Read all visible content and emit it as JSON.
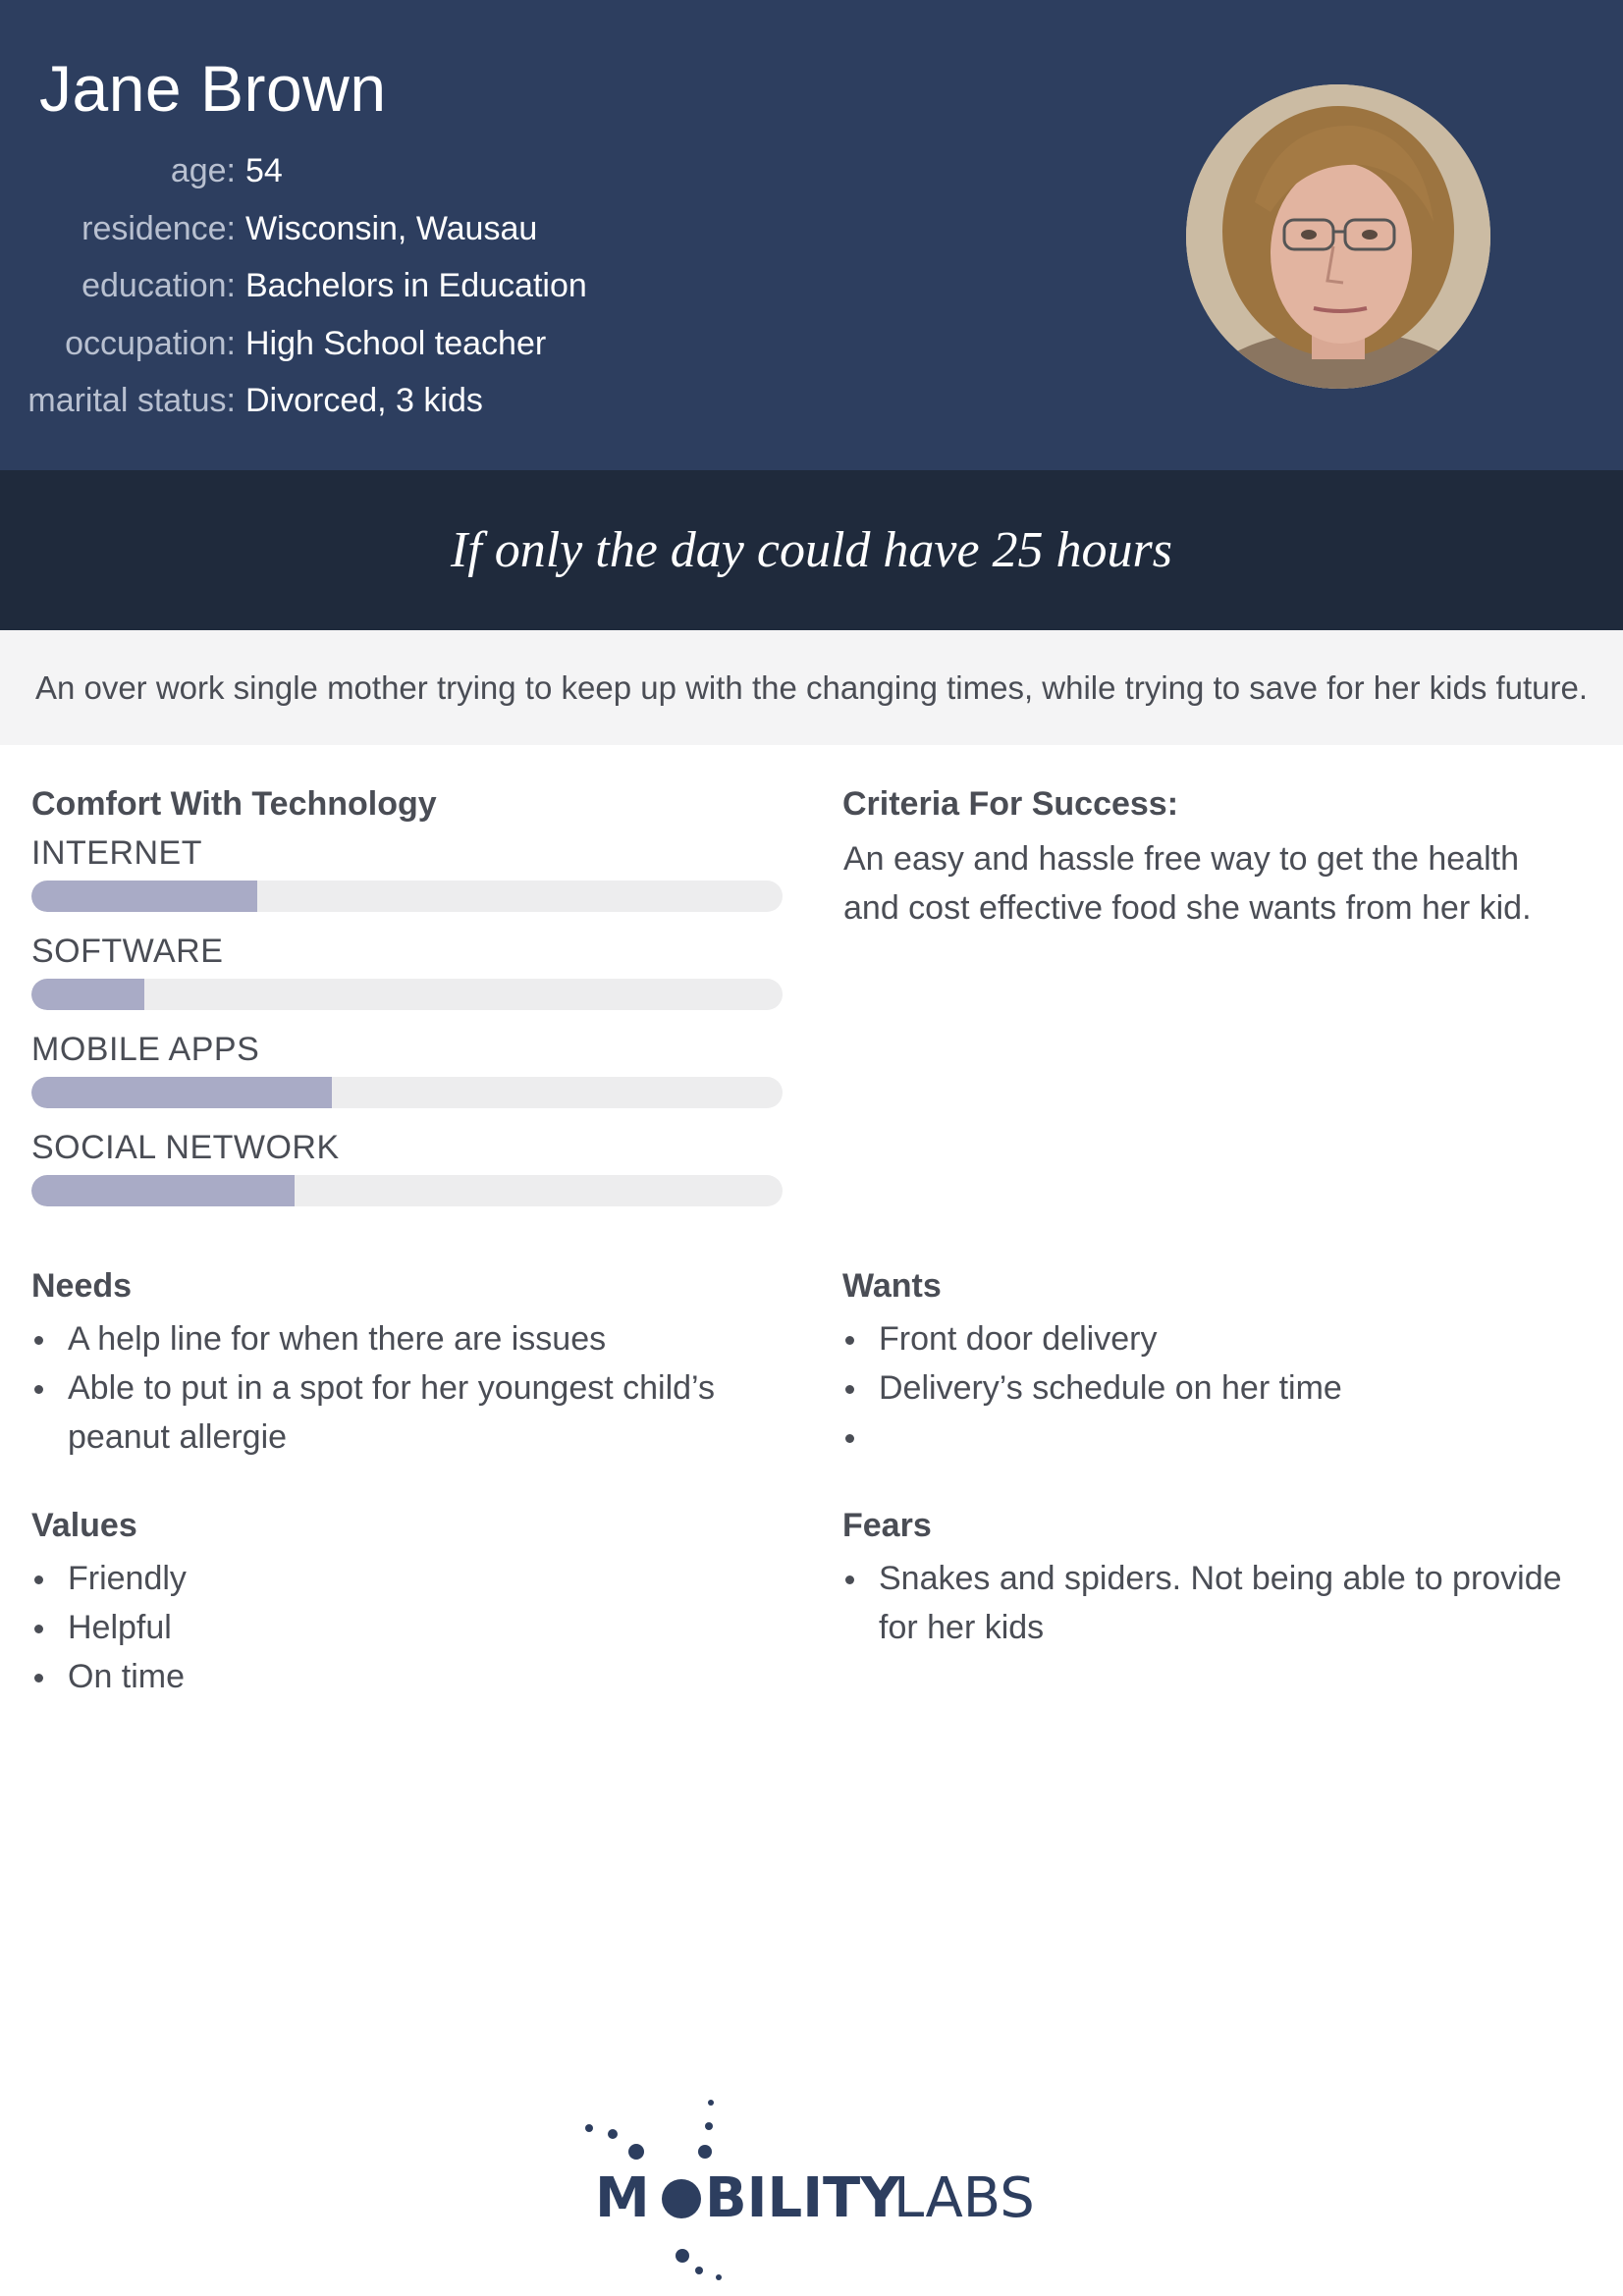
{
  "persona": {
    "name": "Jane Brown",
    "facts": [
      {
        "label": "age:",
        "value": "54"
      },
      {
        "label": "residence:",
        "value": "Wisconsin, Wausau"
      },
      {
        "label": "education:",
        "value": "Bachelors in Education"
      },
      {
        "label": "occupation:",
        "value": "High School teacher"
      },
      {
        "label": "marital status:",
        "value": "Divorced, 3 kids"
      }
    ],
    "quote": "If only the day could have 25 hours",
    "summary": "An over work single mother trying to keep up with the changing times, while trying to save for her kids future."
  },
  "technology": {
    "title": "Comfort With Technology",
    "items": [
      {
        "label": "INTERNET",
        "level": 0.3
      },
      {
        "label": "SOFTWARE",
        "level": 0.15
      },
      {
        "label": "MOBILE APPS",
        "level": 0.4
      },
      {
        "label": "SOCIAL NETWORK",
        "level": 0.35
      }
    ]
  },
  "criteria": {
    "title": "Criteria For Success:",
    "text": "An easy and hassle free way to get the health and cost effective food she wants from her kid."
  },
  "needs": {
    "title": "Needs",
    "items": [
      "A help line for when there are issues",
      "Able to put in a spot for her youngest child’s peanut allergie"
    ]
  },
  "wants": {
    "title": "Wants",
    "items": [
      "Front door delivery",
      "Delivery’s schedule on her time",
      ""
    ]
  },
  "values": {
    "title": "Values",
    "items": [
      "Friendly",
      "Helpful",
      "On time"
    ]
  },
  "fears": {
    "title": "Fears",
    "items": [
      "Snakes and spiders. Not being able to provide for her kids"
    ]
  },
  "brand": {
    "logo_text_dark": "M",
    "logo_text_rest": "BILITY",
    "logo_text_light": "LABS",
    "colors": {
      "header": "#2d3e5f",
      "quote_band": "#1f2a3c",
      "bar_fill": "#a9abc6",
      "logo": "#2d3e5f"
    }
  }
}
